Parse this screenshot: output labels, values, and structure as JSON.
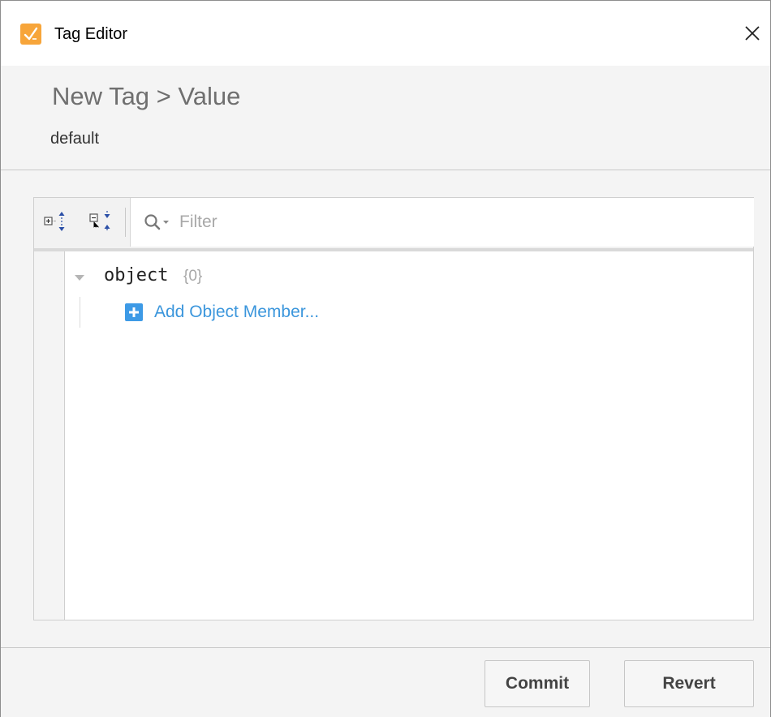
{
  "window": {
    "title": "Tag Editor",
    "close_glyph": "✕",
    "icon": "tag-editor-app-icon"
  },
  "header": {
    "breadcrumb": "New Tag > Value",
    "provider": "default"
  },
  "toolbar": {
    "expand_icon": "expand-all-icon",
    "collapse_icon": "collapse-all-icon",
    "filter_placeholder": "Filter",
    "filter_value": ""
  },
  "tree": {
    "root_key": "object",
    "root_count": "{0}",
    "add_member_label": "Add Object Member..."
  },
  "footer": {
    "commit_label": "Commit",
    "revert_label": "Revert"
  },
  "colors": {
    "accent": "#3b96dc",
    "app_icon": "#f7a53a"
  }
}
